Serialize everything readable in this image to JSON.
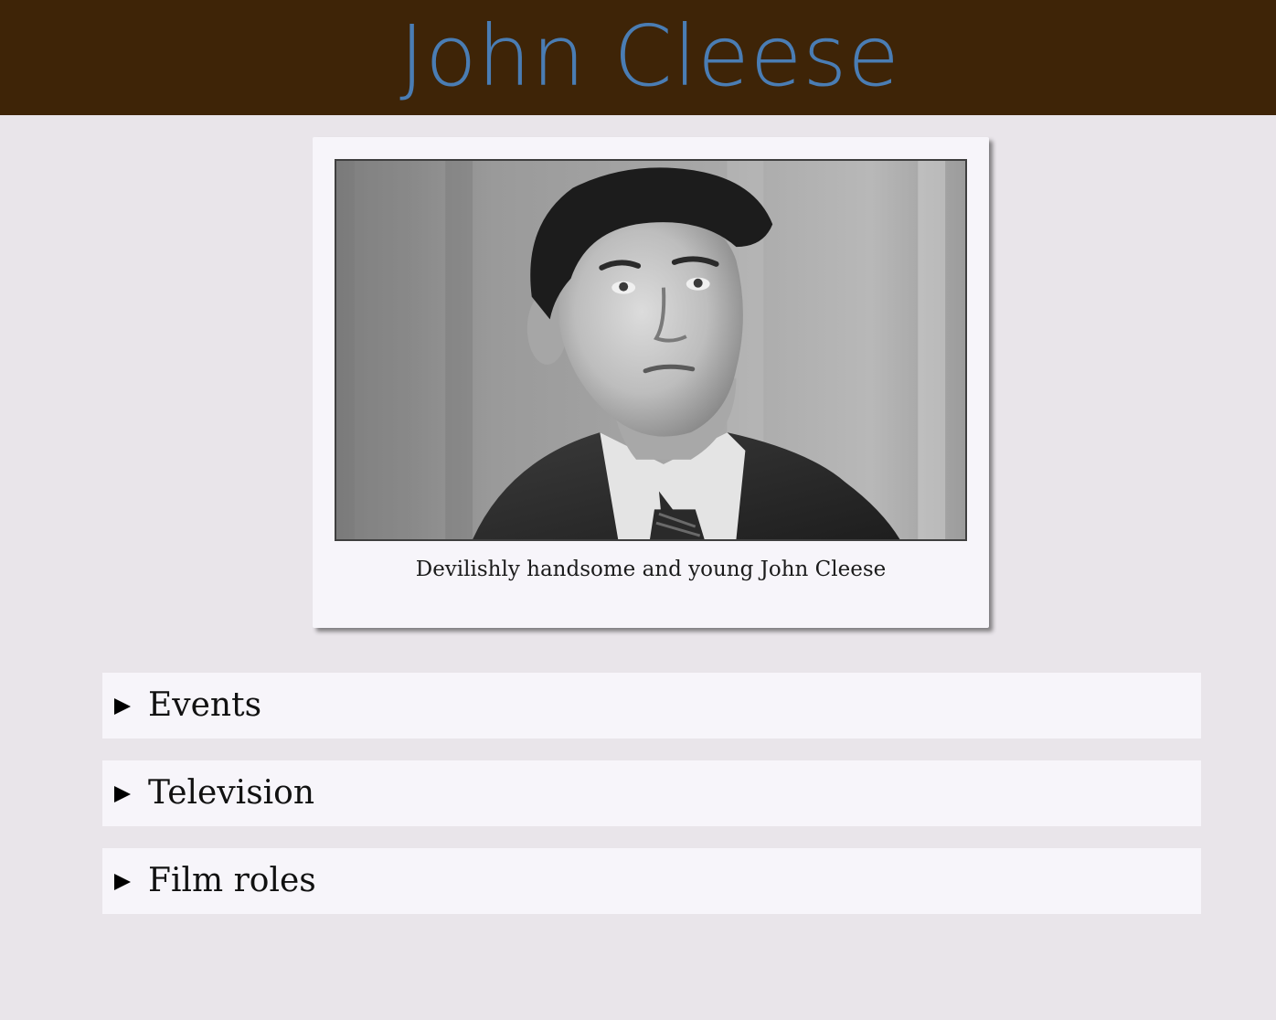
{
  "header": {
    "title": "John Cleese"
  },
  "figure": {
    "image_alt": "Black and white portrait of a young John Cleese in a suit and tie",
    "caption": "Devilishly handsome and young John Cleese"
  },
  "sections": [
    {
      "label": "Events",
      "icon": "triangle-right-icon",
      "expanded": false
    },
    {
      "label": "Television",
      "icon": "triangle-right-icon",
      "expanded": false
    },
    {
      "label": "Film roles",
      "icon": "triangle-right-icon",
      "expanded": false
    }
  ],
  "colors": {
    "header_background": "#3e2407",
    "title_text": "#4a7db4",
    "page_background": "#e9e5ea",
    "card_background": "#f7f5fa"
  }
}
